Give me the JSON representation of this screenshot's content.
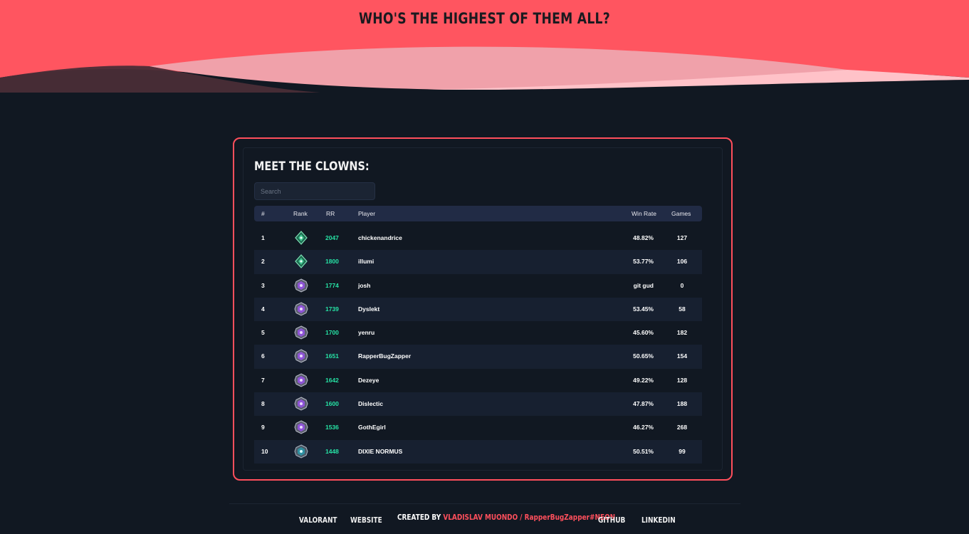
{
  "hero": {
    "title": "WHO'S THE HIGHEST OF THEM ALL?"
  },
  "colors": {
    "accent": "#ff4f5c",
    "rr": "#26e3a5",
    "background": "#111822"
  },
  "leaderboard": {
    "title": "MEET THE CLOWNS:",
    "search_placeholder": "Search",
    "columns": {
      "num": "#",
      "rank": "Rank",
      "rr": "RR",
      "player": "Player",
      "win_rate": "Win Rate",
      "games": "Games"
    },
    "rows": [
      {
        "num": "1",
        "rank_icon": "emerald-rank-icon",
        "rr": "2047",
        "player": "chickenandrice",
        "win_rate": "48.82%",
        "games": "127"
      },
      {
        "num": "2",
        "rank_icon": "emerald-rank-icon",
        "rr": "1800",
        "player": "illumi",
        "win_rate": "53.77%",
        "games": "106"
      },
      {
        "num": "3",
        "rank_icon": "purple-rank-icon",
        "rr": "1774",
        "player": "josh",
        "win_rate": "git gud",
        "games": "0"
      },
      {
        "num": "4",
        "rank_icon": "purple-rank-icon",
        "rr": "1739",
        "player": "Dyslekt",
        "win_rate": "53.45%",
        "games": "58"
      },
      {
        "num": "5",
        "rank_icon": "purple-rank-icon",
        "rr": "1700",
        "player": "yenru",
        "win_rate": "45.60%",
        "games": "182"
      },
      {
        "num": "6",
        "rank_icon": "purple-rank-icon",
        "rr": "1651",
        "player": "RapperBugZapper",
        "win_rate": "50.65%",
        "games": "154"
      },
      {
        "num": "7",
        "rank_icon": "purple-rank-icon",
        "rr": "1642",
        "player": "Dezeye",
        "win_rate": "49.22%",
        "games": "128"
      },
      {
        "num": "8",
        "rank_icon": "purple-rank-icon",
        "rr": "1600",
        "player": "Dislectic",
        "win_rate": "47.87%",
        "games": "188"
      },
      {
        "num": "9",
        "rank_icon": "purple-rank-icon",
        "rr": "1536",
        "player": "GothEgirl",
        "win_rate": "46.27%",
        "games": "268"
      },
      {
        "num": "10",
        "rank_icon": "teal-rank-icon",
        "rr": "1448",
        "player": "DIXIE NORMUS",
        "win_rate": "50.51%",
        "games": "99"
      }
    ]
  },
  "footer": {
    "valorant": "VALORANT",
    "website": "WEBSITE",
    "created_by": "CREATED BY",
    "author": "VLADISLAV MUONDO / RapperBugZapper#NEON",
    "github": "GITHUB",
    "linkedin": "LINKEDIN"
  }
}
